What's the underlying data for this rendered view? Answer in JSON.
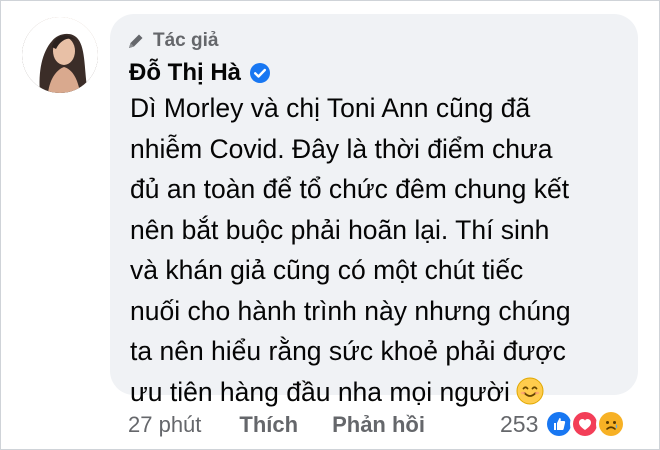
{
  "comment": {
    "author_tag": "Tác giả",
    "author_name": "Đỗ Thị Hà",
    "text_lines": [
      "Dì Morley và chị Toni Ann cũng đã",
      "nhiễm Covid. Đây là thời điểm chưa",
      "đủ an toàn để tổ chức đêm chung kết",
      "nên bắt buộc phải hoãn lại. Thí sinh",
      "và khán giả cũng có một chút tiếc",
      "nuối cho hành trình này nhưng chúng",
      "ta nên hiểu rằng sức khoẻ phải được",
      "ưu tiên hàng đầu nha mọi người"
    ],
    "trailing_emoji": "smiling-face-icon"
  },
  "footer": {
    "time": "27 phút",
    "like_label": "Thích",
    "reply_label": "Phản hồi",
    "reaction_count": "253",
    "reactions": [
      "like-icon",
      "love-icon",
      "sad-icon"
    ]
  },
  "colors": {
    "bubble_bg": "#f0f2f5",
    "text": "#050505",
    "muted": "#65676b",
    "verified": "#1877f2"
  }
}
